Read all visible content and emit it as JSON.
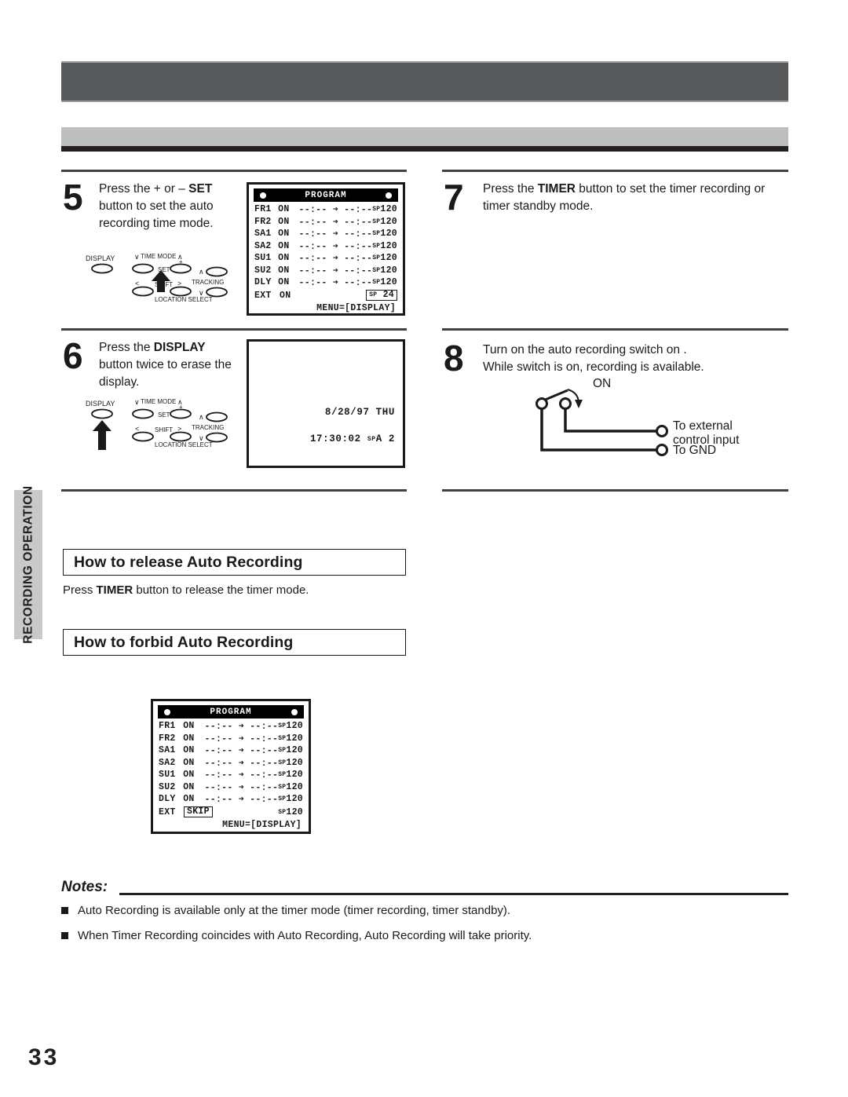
{
  "page": {
    "number": "33",
    "side_tab": "RECORDING\nOPERATION"
  },
  "steps": [
    {
      "number": "5",
      "line1_pre": "Press the + or – ",
      "line1_bold": "SET",
      "line2": "button to set the auto",
      "line3": "recording time mode.",
      "remote_highlight": "set-row"
    },
    {
      "number": "6",
      "line1_pre": "Press the ",
      "line1_bold": "DISPLAY",
      "line2": "button twice to erase the",
      "line3": "display.",
      "remote_highlight": "display-button"
    },
    {
      "number": "7",
      "line1_pre": "Press the ",
      "line1_bold": "TIMER",
      "line1_post": " button to set the timer recording or",
      "line2": "timer standby mode."
    },
    {
      "number": "8",
      "line1": "Turn on the auto recording switch on .",
      "line2": "While switch is on, recording is available."
    }
  ],
  "remote": {
    "display_label": "DISPLAY",
    "time_mode_label": "TIME MODE",
    "set_label": "SET",
    "shift_label": "SHIFT",
    "tracking_label": "TRACKING",
    "location_select_label": "LOCATION SELECT",
    "minus": "–",
    "plus": "+",
    "left": "<",
    "right": ">",
    "up": "∧",
    "down": "∨"
  },
  "program_screen_1": {
    "title": "PROGRAM",
    "rows": [
      {
        "day": "FR1",
        "state": "ON",
        "times": "--:-- ➜ --:--",
        "sp": "SP",
        "rate": "120",
        "boxed": false
      },
      {
        "day": "FR2",
        "state": "ON",
        "times": "--:-- ➜ --:--",
        "sp": "SP",
        "rate": "120",
        "boxed": false
      },
      {
        "day": "SA1",
        "state": "ON",
        "times": "--:-- ➜ --:--",
        "sp": "SP",
        "rate": "120",
        "boxed": false
      },
      {
        "day": "SA2",
        "state": "ON",
        "times": "--:-- ➜ --:--",
        "sp": "SP",
        "rate": "120",
        "boxed": false
      },
      {
        "day": "SU1",
        "state": "ON",
        "times": "--:-- ➜ --:--",
        "sp": "SP",
        "rate": "120",
        "boxed": false
      },
      {
        "day": "SU2",
        "state": "ON",
        "times": "--:-- ➜ --:--",
        "sp": "SP",
        "rate": "120",
        "boxed": false
      },
      {
        "day": "DLY",
        "state": "ON",
        "times": "--:-- ➜ --:--",
        "sp": "SP",
        "rate": "120",
        "boxed": false
      },
      {
        "day": "EXT",
        "state": "ON",
        "times": "",
        "sp": "SP",
        "rate": "24",
        "boxed": true
      }
    ],
    "menu": "MENU=[DISPLAY]"
  },
  "program_screen_2": {
    "title": "PROGRAM",
    "rows": [
      {
        "day": "FR1",
        "state": "ON",
        "times": "--:-- ➜ --:--",
        "sp": "SP",
        "rate": "120",
        "state_boxed": false
      },
      {
        "day": "FR2",
        "state": "ON",
        "times": "--:-- ➜ --:--",
        "sp": "SP",
        "rate": "120",
        "state_boxed": false
      },
      {
        "day": "SA1",
        "state": "ON",
        "times": "--:-- ➜ --:--",
        "sp": "SP",
        "rate": "120",
        "state_boxed": false
      },
      {
        "day": "SA2",
        "state": "ON",
        "times": "--:-- ➜ --:--",
        "sp": "SP",
        "rate": "120",
        "state_boxed": false
      },
      {
        "day": "SU1",
        "state": "ON",
        "times": "--:-- ➜ --:--",
        "sp": "SP",
        "rate": "120",
        "state_boxed": false
      },
      {
        "day": "SU2",
        "state": "ON",
        "times": "--:-- ➜ --:--",
        "sp": "SP",
        "rate": "120",
        "state_boxed": false
      },
      {
        "day": "DLY",
        "state": "ON",
        "times": "--:-- ➜ --:--",
        "sp": "SP",
        "rate": "120",
        "state_boxed": false
      },
      {
        "day": "EXT",
        "state": "SKIP",
        "times": "",
        "sp": "SP",
        "rate": "120",
        "state_boxed": true
      }
    ],
    "menu": "MENU=[DISPLAY]"
  },
  "tv_screen": {
    "date": "8/28/97 THU",
    "time": "17:30:02",
    "sp": "SP",
    "mode": "A 2"
  },
  "switch_diagram": {
    "on_label": "ON",
    "external_label_l1": "To external",
    "external_label_l2": "control input",
    "gnd_label": "To GND"
  },
  "sections": [
    {
      "heading": "How to release Auto Recording",
      "body_pre": "Press ",
      "body_bold": "TIMER",
      "body_post": " button to release the timer mode."
    },
    {
      "heading": "How to forbid Auto Recording"
    }
  ],
  "notes": {
    "title": "Notes:",
    "items": [
      "Auto Recording is available only at the timer mode (timer recording, timer standby).",
      "When Timer Recording coincides with Auto Recording, Auto Recording will take priority."
    ]
  },
  "colors": {
    "header_dark": "#58595b",
    "header_light": "#bcbec0",
    "header_rule": "#231f20",
    "side_tab": "#c7c9cb",
    "ink": "#1a1a1a"
  }
}
